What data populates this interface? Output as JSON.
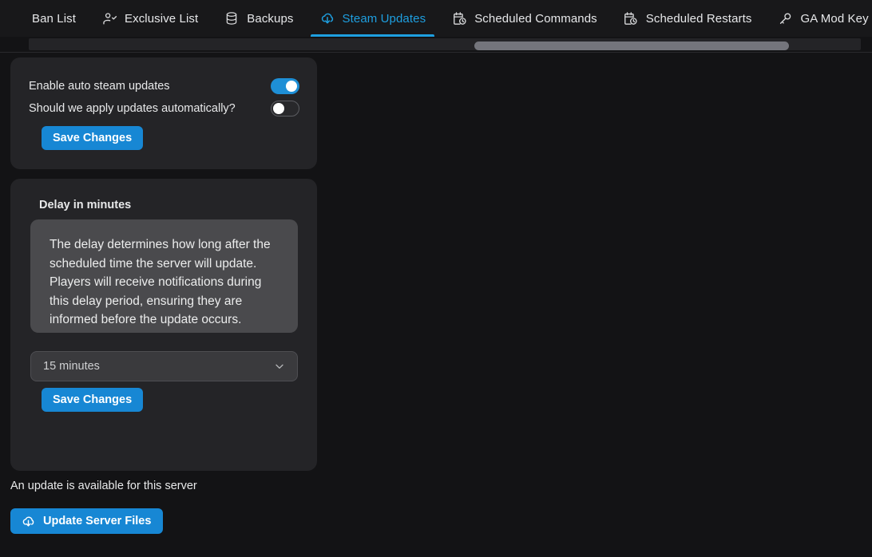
{
  "tabs": [
    {
      "label": "Ban List",
      "icon": "",
      "active": false
    },
    {
      "label": "Exclusive List",
      "icon": "user-check-icon",
      "active": false
    },
    {
      "label": "Backups",
      "icon": "database-icon",
      "active": false
    },
    {
      "label": "Steam Updates",
      "icon": "cloud-download-icon",
      "active": true
    },
    {
      "label": "Scheduled Commands",
      "icon": "calendar-clock-icon",
      "active": false
    },
    {
      "label": "Scheduled Restarts",
      "icon": "calendar-clock-icon",
      "active": false
    },
    {
      "label": "GA Mod Key",
      "icon": "key-icon",
      "active": false
    }
  ],
  "auto_update_card": {
    "enable_label": "Enable auto steam updates",
    "enable_state": "on",
    "apply_label": "Should we apply updates automatically?",
    "apply_state": "off",
    "save_label": "Save Changes"
  },
  "delay_card": {
    "title": "Delay in minutes",
    "description": "The delay determines how long after the scheduled time the server will update. Players will receive notifications during this delay period, ensuring they are informed before the update occurs.",
    "selected_option": "15 minutes",
    "save_label": "Save Changes"
  },
  "update_section": {
    "notice": "An update is available for this server",
    "button_label": "Update Server Files",
    "button_icon": "cloud-download-icon"
  },
  "colors": {
    "accent": "#1e9fe0",
    "button": "#1787d4",
    "toggle_on": "#1e8fd6",
    "page_bg": "#131315",
    "card_bg": "#242427",
    "desc_bg": "#4a4a4d"
  }
}
